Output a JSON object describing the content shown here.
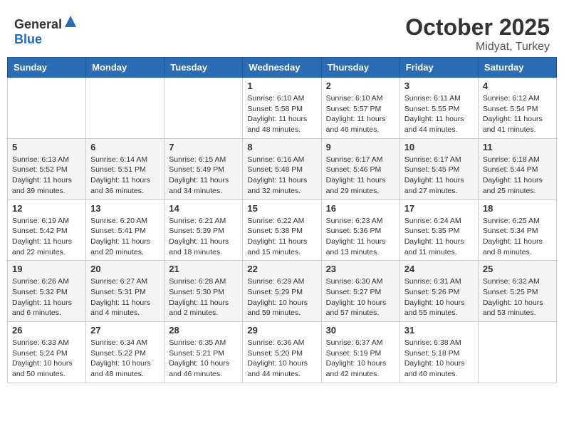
{
  "header": {
    "logo_general": "General",
    "logo_blue": "Blue",
    "month": "October 2025",
    "location": "Midyat, Turkey"
  },
  "weekdays": [
    "Sunday",
    "Monday",
    "Tuesday",
    "Wednesday",
    "Thursday",
    "Friday",
    "Saturday"
  ],
  "weeks": [
    [
      {
        "day": "",
        "info": ""
      },
      {
        "day": "",
        "info": ""
      },
      {
        "day": "",
        "info": ""
      },
      {
        "day": "1",
        "info": "Sunrise: 6:10 AM\nSunset: 5:58 PM\nDaylight: 11 hours\nand 48 minutes."
      },
      {
        "day": "2",
        "info": "Sunrise: 6:10 AM\nSunset: 5:57 PM\nDaylight: 11 hours\nand 46 minutes."
      },
      {
        "day": "3",
        "info": "Sunrise: 6:11 AM\nSunset: 5:55 PM\nDaylight: 11 hours\nand 44 minutes."
      },
      {
        "day": "4",
        "info": "Sunrise: 6:12 AM\nSunset: 5:54 PM\nDaylight: 11 hours\nand 41 minutes."
      }
    ],
    [
      {
        "day": "5",
        "info": "Sunrise: 6:13 AM\nSunset: 5:52 PM\nDaylight: 11 hours\nand 39 minutes."
      },
      {
        "day": "6",
        "info": "Sunrise: 6:14 AM\nSunset: 5:51 PM\nDaylight: 11 hours\nand 36 minutes."
      },
      {
        "day": "7",
        "info": "Sunrise: 6:15 AM\nSunset: 5:49 PM\nDaylight: 11 hours\nand 34 minutes."
      },
      {
        "day": "8",
        "info": "Sunrise: 6:16 AM\nSunset: 5:48 PM\nDaylight: 11 hours\nand 32 minutes."
      },
      {
        "day": "9",
        "info": "Sunrise: 6:17 AM\nSunset: 5:46 PM\nDaylight: 11 hours\nand 29 minutes."
      },
      {
        "day": "10",
        "info": "Sunrise: 6:17 AM\nSunset: 5:45 PM\nDaylight: 11 hours\nand 27 minutes."
      },
      {
        "day": "11",
        "info": "Sunrise: 6:18 AM\nSunset: 5:44 PM\nDaylight: 11 hours\nand 25 minutes."
      }
    ],
    [
      {
        "day": "12",
        "info": "Sunrise: 6:19 AM\nSunset: 5:42 PM\nDaylight: 11 hours\nand 22 minutes."
      },
      {
        "day": "13",
        "info": "Sunrise: 6:20 AM\nSunset: 5:41 PM\nDaylight: 11 hours\nand 20 minutes."
      },
      {
        "day": "14",
        "info": "Sunrise: 6:21 AM\nSunset: 5:39 PM\nDaylight: 11 hours\nand 18 minutes."
      },
      {
        "day": "15",
        "info": "Sunrise: 6:22 AM\nSunset: 5:38 PM\nDaylight: 11 hours\nand 15 minutes."
      },
      {
        "day": "16",
        "info": "Sunrise: 6:23 AM\nSunset: 5:36 PM\nDaylight: 11 hours\nand 13 minutes."
      },
      {
        "day": "17",
        "info": "Sunrise: 6:24 AM\nSunset: 5:35 PM\nDaylight: 11 hours\nand 11 minutes."
      },
      {
        "day": "18",
        "info": "Sunrise: 6:25 AM\nSunset: 5:34 PM\nDaylight: 11 hours\nand 8 minutes."
      }
    ],
    [
      {
        "day": "19",
        "info": "Sunrise: 6:26 AM\nSunset: 5:32 PM\nDaylight: 11 hours\nand 6 minutes."
      },
      {
        "day": "20",
        "info": "Sunrise: 6:27 AM\nSunset: 5:31 PM\nDaylight: 11 hours\nand 4 minutes."
      },
      {
        "day": "21",
        "info": "Sunrise: 6:28 AM\nSunset: 5:30 PM\nDaylight: 11 hours\nand 2 minutes."
      },
      {
        "day": "22",
        "info": "Sunrise: 6:29 AM\nSunset: 5:29 PM\nDaylight: 10 hours\nand 59 minutes."
      },
      {
        "day": "23",
        "info": "Sunrise: 6:30 AM\nSunset: 5:27 PM\nDaylight: 10 hours\nand 57 minutes."
      },
      {
        "day": "24",
        "info": "Sunrise: 6:31 AM\nSunset: 5:26 PM\nDaylight: 10 hours\nand 55 minutes."
      },
      {
        "day": "25",
        "info": "Sunrise: 6:32 AM\nSunset: 5:25 PM\nDaylight: 10 hours\nand 53 minutes."
      }
    ],
    [
      {
        "day": "26",
        "info": "Sunrise: 6:33 AM\nSunset: 5:24 PM\nDaylight: 10 hours\nand 50 minutes."
      },
      {
        "day": "27",
        "info": "Sunrise: 6:34 AM\nSunset: 5:22 PM\nDaylight: 10 hours\nand 48 minutes."
      },
      {
        "day": "28",
        "info": "Sunrise: 6:35 AM\nSunset: 5:21 PM\nDaylight: 10 hours\nand 46 minutes."
      },
      {
        "day": "29",
        "info": "Sunrise: 6:36 AM\nSunset: 5:20 PM\nDaylight: 10 hours\nand 44 minutes."
      },
      {
        "day": "30",
        "info": "Sunrise: 6:37 AM\nSunset: 5:19 PM\nDaylight: 10 hours\nand 42 minutes."
      },
      {
        "day": "31",
        "info": "Sunrise: 6:38 AM\nSunset: 5:18 PM\nDaylight: 10 hours\nand 40 minutes."
      },
      {
        "day": "",
        "info": ""
      }
    ]
  ]
}
